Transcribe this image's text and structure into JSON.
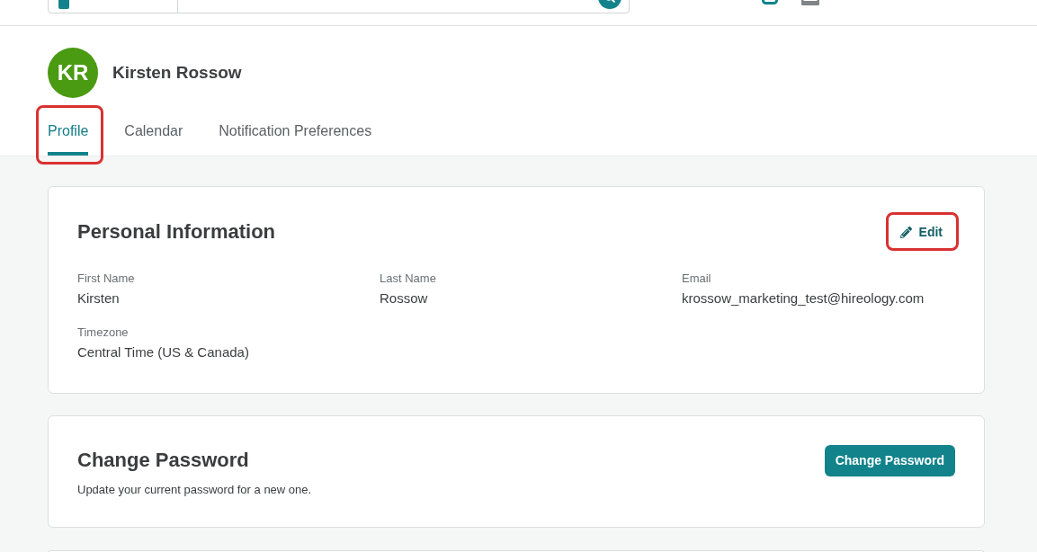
{
  "profile": {
    "initials": "KR",
    "name": "Kirsten Rossow"
  },
  "tabs": [
    {
      "label": "Profile",
      "selected": true,
      "highlighted": true
    },
    {
      "label": "Calendar",
      "selected": false,
      "highlighted": false
    },
    {
      "label": "Notification Preferences",
      "selected": false,
      "highlighted": false
    }
  ],
  "personal_information": {
    "title": "Personal Information",
    "edit_button": {
      "label": "Edit",
      "highlighted": true
    },
    "fields": [
      {
        "label": "First Name",
        "value": "Kirsten"
      },
      {
        "label": "Last Name",
        "value": "Rossow"
      },
      {
        "label": "Email",
        "value": "krossow_marketing_test@hireology.com"
      },
      {
        "label": "Timezone",
        "value": "Central Time (US & Canada)"
      }
    ]
  },
  "change_password": {
    "title": "Change Password",
    "description": "Update your current password for a new one.",
    "button": "Change Password"
  }
}
